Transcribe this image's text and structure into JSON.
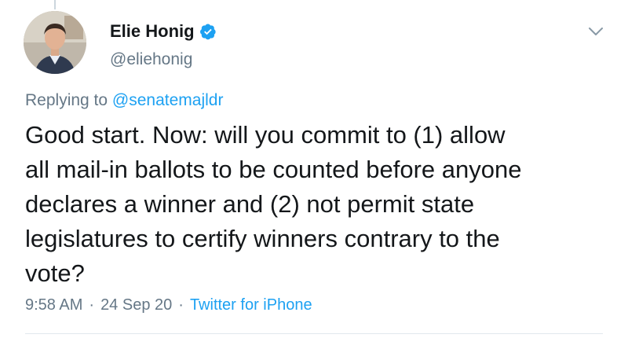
{
  "author": {
    "display_name": "Elie Honig",
    "handle": "@eliehonig",
    "verified": true
  },
  "reply": {
    "prefix": "Replying to ",
    "to_handle": "@senatemajldr"
  },
  "tweet": {
    "text": "Good start. Now: will you commit to (1) allow\nall mail-in ballots to be counted before anyone\ndeclares a winner and (2) not permit state\nlegislatures to certify winners contrary to the\nvote?"
  },
  "meta": {
    "time": "9:58 AM",
    "date": "24 Sep 20",
    "separator": "·",
    "source": "Twitter for iPhone"
  },
  "colors": {
    "accent": "#1da1f2",
    "secondary_text": "#657786",
    "primary_text": "#14171a"
  },
  "icons": {
    "verified": "verified-badge-icon",
    "more": "chevron-down-icon"
  }
}
